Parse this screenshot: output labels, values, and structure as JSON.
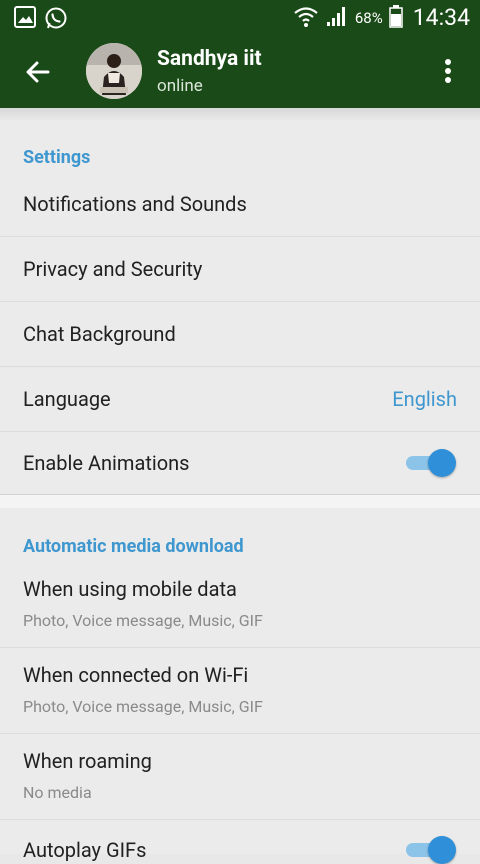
{
  "status_bar": {
    "battery_pct": "68%",
    "time": "14:34",
    "icons": [
      "image-icon",
      "whatsapp-icon",
      "wifi-icon",
      "signal-icon",
      "battery-icon"
    ]
  },
  "header": {
    "contact_name": "Sandhya iit",
    "status": "online"
  },
  "settings": {
    "title": "Settings",
    "items": [
      {
        "label": "Notifications and Sounds"
      },
      {
        "label": "Privacy and Security"
      },
      {
        "label": "Chat Background"
      },
      {
        "label": "Language",
        "value": "English"
      },
      {
        "label": "Enable Animations",
        "toggle": true
      }
    ]
  },
  "media": {
    "title": "Automatic media download",
    "items": [
      {
        "label": "When using mobile data",
        "sub": "Photo, Voice message, Music, GIF"
      },
      {
        "label": "When connected on Wi-Fi",
        "sub": "Photo, Voice message, Music, GIF"
      },
      {
        "label": "When roaming",
        "sub": "No media"
      },
      {
        "label": "Autoplay GIFs",
        "toggle": true
      }
    ]
  },
  "colors": {
    "app_bar": "#1a4a17",
    "accent": "#3f97cf",
    "toggle": "#2f8fd8"
  }
}
